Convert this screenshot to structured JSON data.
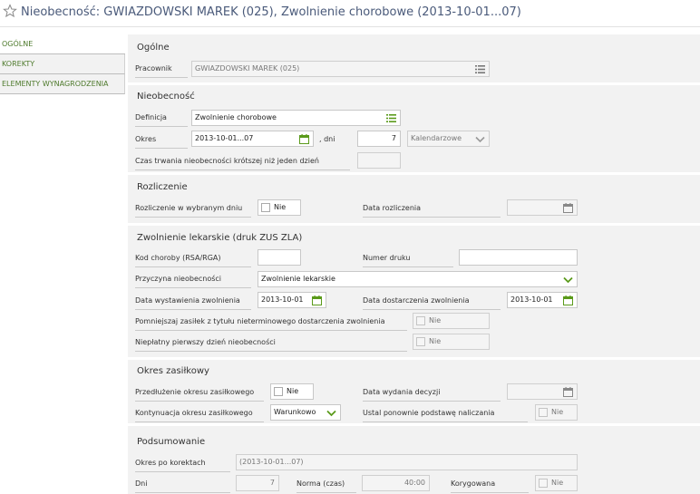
{
  "header": {
    "title": "Nieobecność: GWIAZDOWSKI MAREK (025), Zwolnienie chorobowe (2013-10-01...07)"
  },
  "nav": {
    "items": [
      {
        "label": "OGÓLNE"
      },
      {
        "label": "KOREKTY"
      },
      {
        "label": "ELEMENTY WYNAGRODZENIA"
      }
    ]
  },
  "ogolne": {
    "title": "Ogólne",
    "pracownik_label": "Pracownik",
    "pracownik_value": "GWIAZDOWSKI MAREK (025)"
  },
  "nieobecnosc": {
    "title": "Nieobecność",
    "definicja_label": "Definicja",
    "definicja_value": "Zwolnienie chorobowe",
    "okres_label": "Okres",
    "okres_value": "2013-10-01...07",
    "dni_label": ", dni",
    "dni_value": "7",
    "kalendarz_value": "Kalendarzowe",
    "czas_label": "Czas trwania nieobecności krótszej niż jeden dzień",
    "czas_value": ""
  },
  "rozliczenie": {
    "title": "Rozliczenie",
    "w_dniu_label": "Rozliczenie w wybranym dniu",
    "w_dniu_value": "Nie",
    "data_label": "Data rozliczenia",
    "data_value": ""
  },
  "zwolnienie": {
    "title": "Zwolnienie lekarskie (druk ZUS ZLA)",
    "kod_label": "Kod choroby (RSA/RGA)",
    "kod_value": "",
    "numer_label": "Numer druku",
    "numer_value": "",
    "przyczyna_label": "Przyczyna nieobecności",
    "przyczyna_value": "Zwolnienie lekarskie",
    "data_wyst_label": "Data wystawienia zwolnienia",
    "data_wyst_value": "2013-10-01",
    "data_dost_label": "Data dostarczenia zwolnienia",
    "data_dost_value": "2013-10-01",
    "pomniejszaj_label": "Pomniejszaj zasiłek z tytułu nieterminowego dostarczenia zwolnienia",
    "pomniejszaj_value": "Nie",
    "nieplatny_label": "Niepłatny pierwszy dzień nieobecności",
    "nieplatny_value": "Nie"
  },
  "okres_zasilkowy": {
    "title": "Okres zasiłkowy",
    "przedluzenie_label": "Przedłużenie okresu zasiłkowego",
    "przedluzenie_value": "Nie",
    "data_wyd_label": "Data wydania decyzji",
    "data_wyd_value": "",
    "kontynuacja_label": "Kontynuacja okresu zasiłkowego",
    "kontynuacja_value": "Warunkowo",
    "ustal_label": "Ustal ponownie podstawę naliczania",
    "ustal_value": "Nie"
  },
  "podsumowanie": {
    "title": "Podsumowanie",
    "okres_po_label": "Okres po korektach",
    "okres_po_value": "(2013-10-01...07)",
    "dni_label": "Dni",
    "dni_value": "7",
    "norma_label": "Norma (czas)",
    "norma_value": "40:00",
    "korygowana_label": "Korygowana",
    "korygowana_value": "Nie"
  },
  "colors": {
    "accent": "#5a9a1a",
    "label_green": "#4e7a2c",
    "title": "#4a5a7a"
  }
}
